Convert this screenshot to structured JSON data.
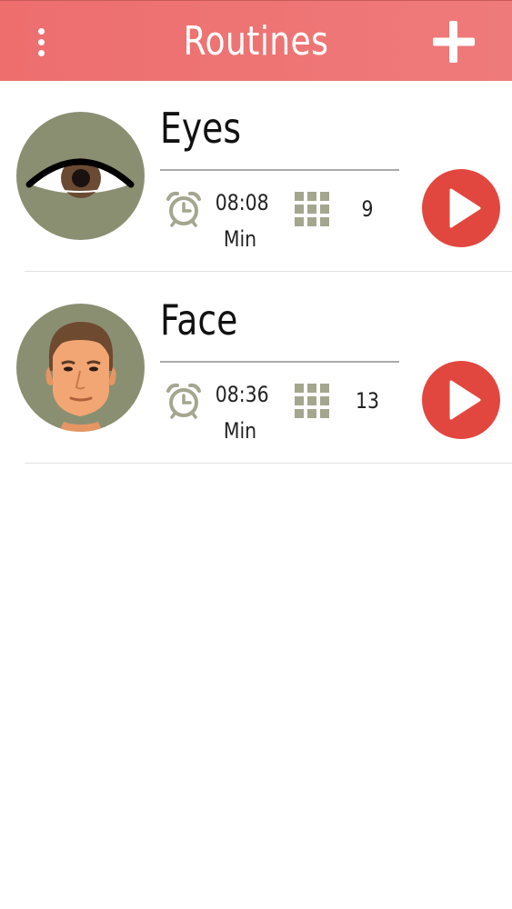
{
  "header": {
    "title": "Routines",
    "menu_icon": "more-vertical-icon",
    "add_icon": "plus-icon"
  },
  "colors": {
    "header_bg": "#ee6e6e",
    "play_button": "#e2473f",
    "avatar_bg": "#8a8f72",
    "stat_icon": "#a4a68e"
  },
  "routines": [
    {
      "name": "Eyes",
      "duration": "08:08",
      "duration_unit": "Min",
      "exercise_count": "9",
      "avatar_icon": "eye-icon"
    },
    {
      "name": "Face",
      "duration": "08:36",
      "duration_unit": "Min",
      "exercise_count": "13",
      "avatar_icon": "face-icon"
    }
  ]
}
